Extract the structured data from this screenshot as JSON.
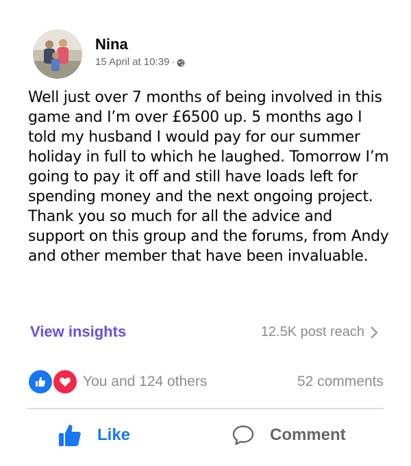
{
  "post": {
    "author": "Nina",
    "date": "15 April at 10:39",
    "separator": "·",
    "privacy_icon": "globe-icon",
    "text": "Well just over 7 months of being involved in this game and I’m over £6500 up. 5 months ago I told my husband I would pay for our summer holiday in full to which he laughed. Tomorrow I’m going to pay it off and still have loads left for spending money and the next ongoing project. Thank you so much for all the advice and support on this group and the forums, from Andy and other member that have been invaluable."
  },
  "insights": {
    "label": "View insights",
    "reach": "12.5K post reach"
  },
  "reactions": {
    "icons": [
      "like-reaction-icon",
      "love-reaction-icon"
    ],
    "summary": "You and 124 others",
    "comments": "52 comments"
  },
  "actions": {
    "like": "Like",
    "comment": "Comment"
  },
  "colors": {
    "accent_blue": "#1877f2",
    "love_red": "#f02849",
    "insights_purple": "#6b4fd8",
    "muted_gray": "#8a8d91"
  }
}
